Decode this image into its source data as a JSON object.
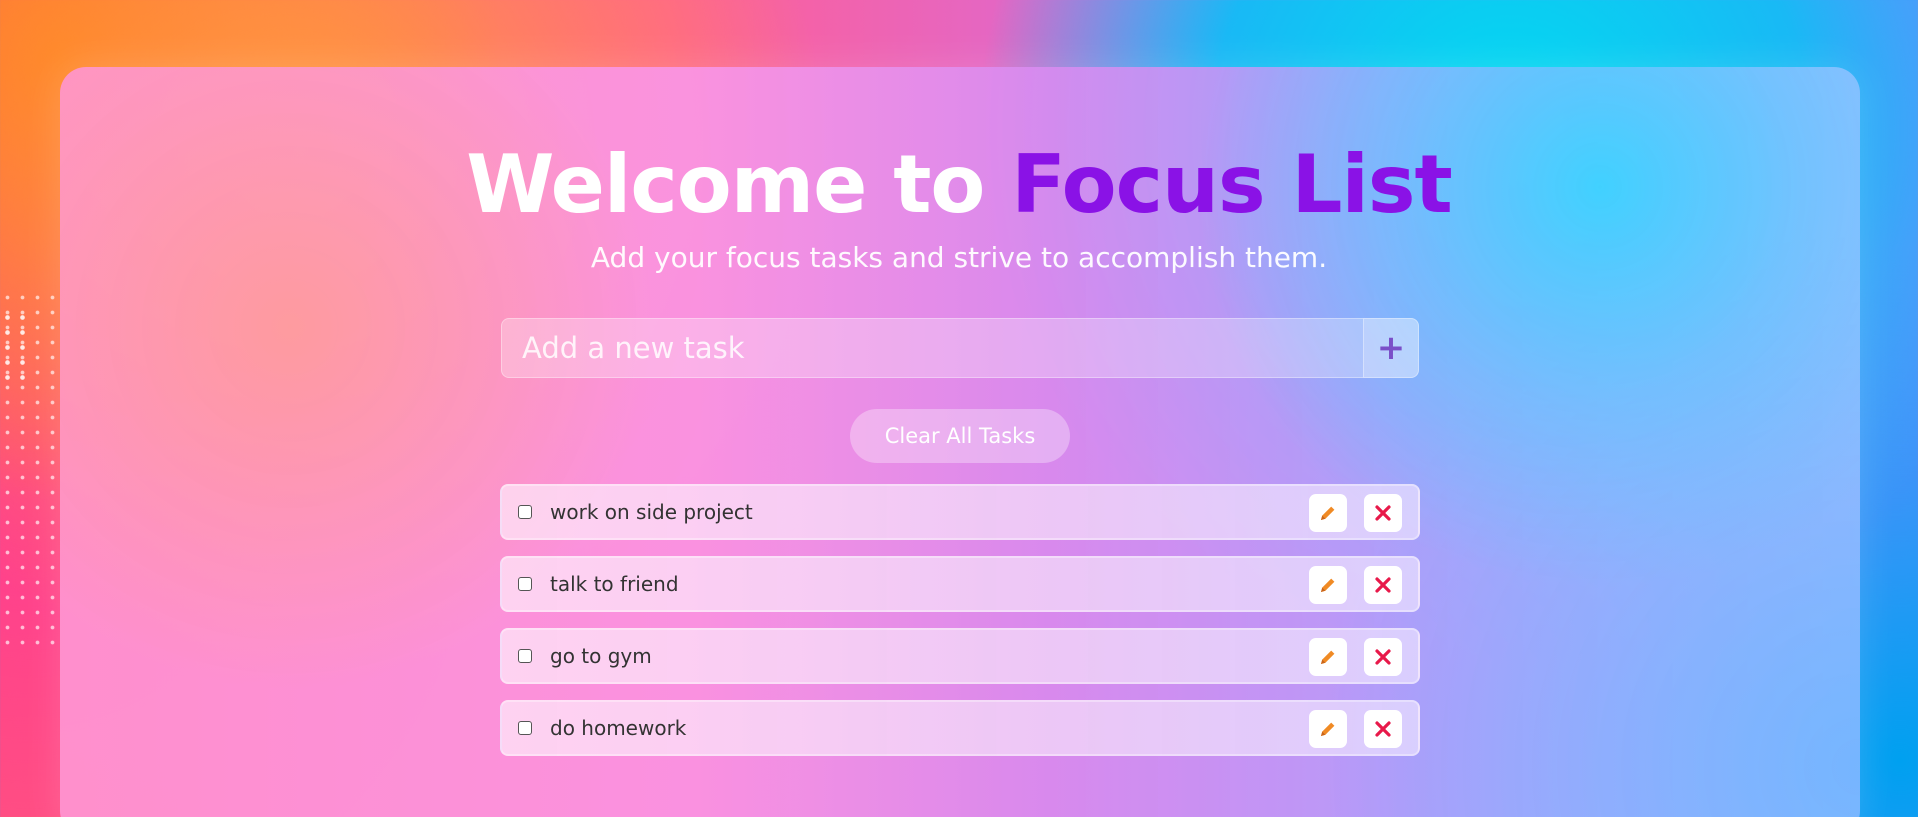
{
  "header": {
    "title_prefix": "Welcome to",
    "title_brand": "Focus List",
    "subtitle": "Add your focus tasks and strive to accomplish them."
  },
  "input": {
    "placeholder": "Add a new task",
    "value": "",
    "add_label": "+"
  },
  "clear_label": "Clear All Tasks",
  "tasks": [
    {
      "label": "work on side project",
      "checked": false
    },
    {
      "label": "talk to friend",
      "checked": false
    },
    {
      "label": "go to gym",
      "checked": false
    },
    {
      "label": "do homework",
      "checked": false
    }
  ],
  "icons": {
    "edit": "pencil-icon",
    "delete": "close-icon"
  },
  "colors": {
    "brand": "#8a12e6",
    "edit_icon": "#f08a24",
    "delete_icon": "#e8194a"
  }
}
